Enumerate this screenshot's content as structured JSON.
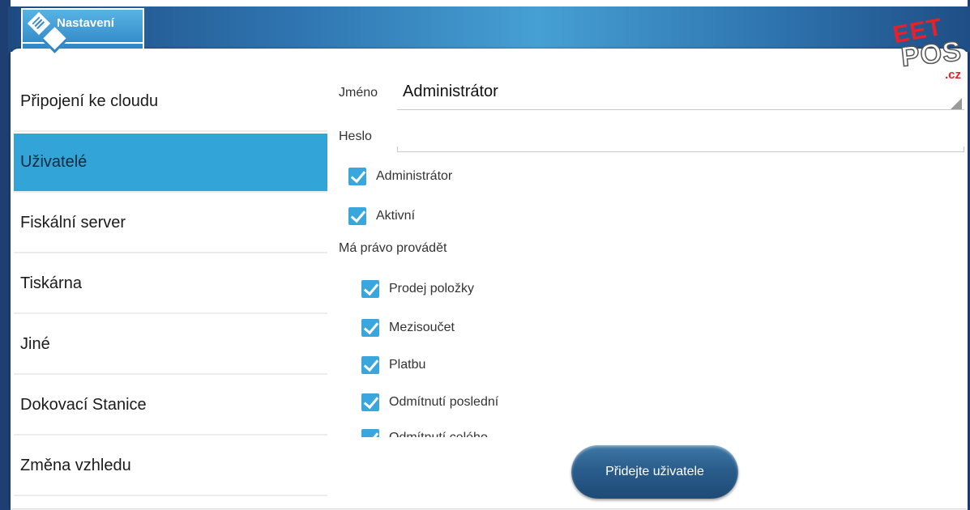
{
  "header": {
    "tab_label": "Nastavení"
  },
  "logo": {
    "line1": "EET",
    "line2": "POS",
    "line3": ".cz"
  },
  "sidebar": {
    "items": [
      {
        "label": "Připojení ke cloudu",
        "active": false
      },
      {
        "label": "Uživatelé",
        "active": true
      },
      {
        "label": "Fiskální server",
        "active": false
      },
      {
        "label": "Tiskárna",
        "active": false
      },
      {
        "label": "Jiné",
        "active": false
      },
      {
        "label": "Dokovací Stanice",
        "active": false
      },
      {
        "label": "Změna vzhledu",
        "active": false
      }
    ]
  },
  "form": {
    "name_label": "Jméno",
    "name_value": "Administrátor",
    "password_label": "Heslo",
    "password_value": "",
    "admin_checkbox": {
      "label": "Administrátor",
      "checked": true
    },
    "active_checkbox": {
      "label": "Aktivní",
      "checked": true
    },
    "permissions_label": "Má právo provádět",
    "permissions": [
      {
        "label": "Prodej položky",
        "checked": true
      },
      {
        "label": "Mezisoučet",
        "checked": true
      },
      {
        "label": "Platbu",
        "checked": true
      },
      {
        "label": "Odmítnutí poslední",
        "checked": true
      },
      {
        "label": "Odmítnutí celého",
        "checked": true
      }
    ]
  },
  "actions": {
    "add_user_label": "Přidejte uživatele"
  },
  "colors": {
    "accent": "#33a4d8",
    "checkbox": "#3aa6de",
    "header": "#2f75b1",
    "button": "#2a5d8c"
  }
}
